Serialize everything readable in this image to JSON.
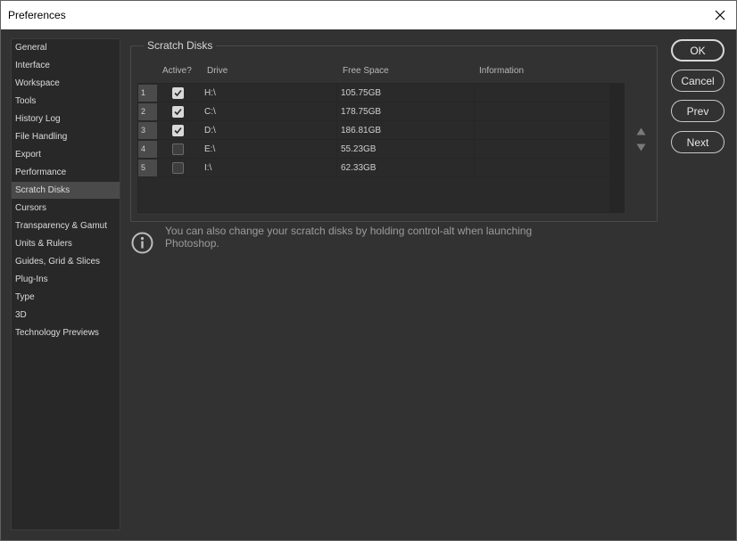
{
  "window": {
    "title": "Preferences"
  },
  "sidebar": {
    "items": [
      {
        "label": "General"
      },
      {
        "label": "Interface"
      },
      {
        "label": "Workspace"
      },
      {
        "label": "Tools"
      },
      {
        "label": "History Log"
      },
      {
        "label": "File Handling"
      },
      {
        "label": "Export"
      },
      {
        "label": "Performance"
      },
      {
        "label": "Scratch Disks",
        "selected": true
      },
      {
        "label": "Cursors"
      },
      {
        "label": "Transparency & Gamut"
      },
      {
        "label": "Units & Rulers"
      },
      {
        "label": "Guides, Grid & Slices"
      },
      {
        "label": "Plug-Ins"
      },
      {
        "label": "Type"
      },
      {
        "label": "3D"
      },
      {
        "label": "Technology Previews"
      }
    ]
  },
  "scratch": {
    "group_label": "Scratch Disks",
    "headers": {
      "active": "Active?",
      "drive": "Drive",
      "free": "Free Space",
      "info": "Information"
    },
    "rows": [
      {
        "num": "1",
        "active": true,
        "drive": "H:\\",
        "free": "105.75GB",
        "info": ""
      },
      {
        "num": "2",
        "active": true,
        "drive": "C:\\",
        "free": "178.75GB",
        "info": ""
      },
      {
        "num": "3",
        "active": true,
        "drive": "D:\\",
        "free": "186.81GB",
        "info": ""
      },
      {
        "num": "4",
        "active": false,
        "drive": "E:\\",
        "free": "55.23GB",
        "info": ""
      },
      {
        "num": "5",
        "active": false,
        "drive": "I:\\",
        "free": "62.33GB",
        "info": ""
      }
    ],
    "info_text": "You can also change your scratch disks by holding control-alt when launching Photoshop."
  },
  "buttons": {
    "ok": "OK",
    "cancel": "Cancel",
    "prev": "Prev",
    "next": "Next"
  },
  "icons": {
    "close": "close-icon",
    "info": "info-icon",
    "up": "arrow-up-icon",
    "down": "arrow-down-icon",
    "check": "checkmark-icon"
  }
}
